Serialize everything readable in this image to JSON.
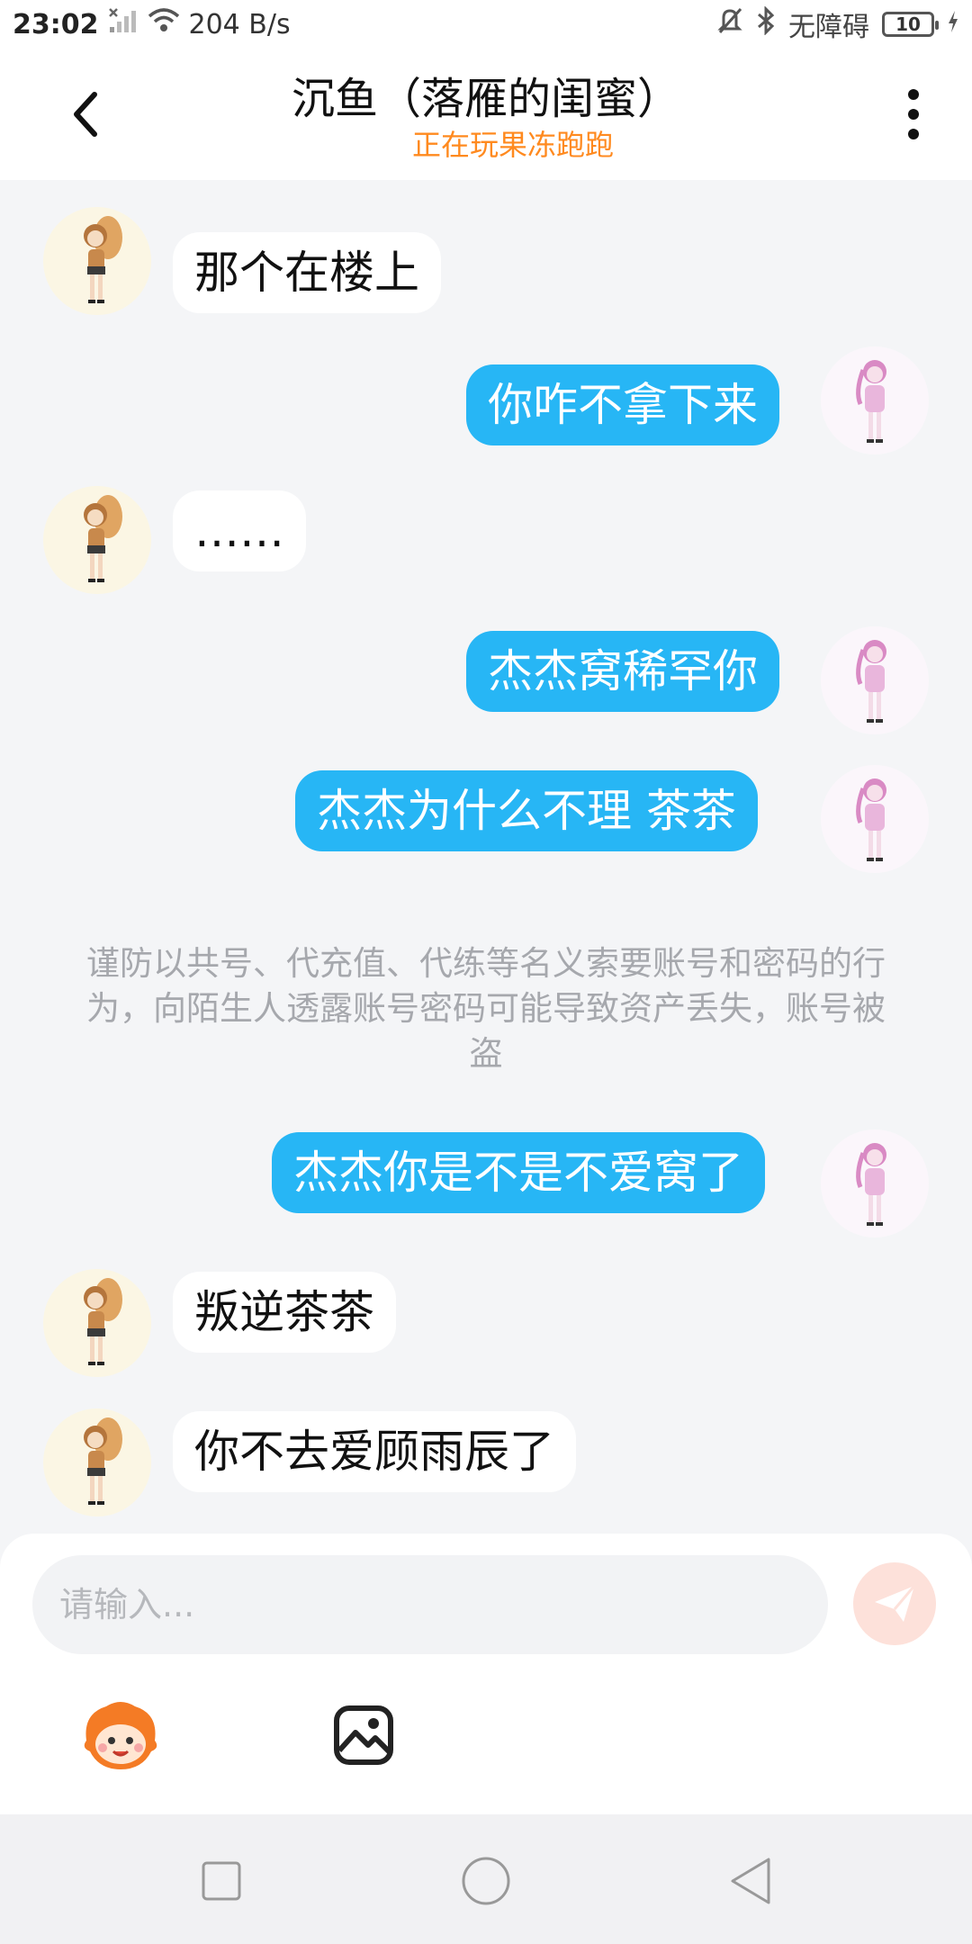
{
  "status_bar": {
    "time": "23:02",
    "net_speed": "204 B/s",
    "accessibility": "无障碍",
    "battery": "10",
    "icons": [
      "no-sim-signal-icon",
      "wifi-icon",
      "mute-icon",
      "bluetooth-icon",
      "battery-icon",
      "charging-icon"
    ]
  },
  "header": {
    "title": "沉鱼（落雁的闺蜜）",
    "subtitle": "正在玩果冻跑跑",
    "subtitle_color": "#ff8a1f",
    "back_icon": "chevron-left-icon",
    "more_icon": "more-vertical-icon"
  },
  "messages": [
    {
      "side": "in",
      "text": "那个在楼上"
    },
    {
      "side": "out",
      "text": "你咋不拿下来"
    },
    {
      "side": "in",
      "text": "……"
    },
    {
      "side": "out",
      "text": "杰杰窝稀罕你"
    },
    {
      "side": "out",
      "text": "杰杰为什么不理  茶茶"
    },
    {
      "side": "out",
      "text": "杰杰你是不是不爱窝了"
    },
    {
      "side": "in",
      "text": "叛逆茶茶"
    },
    {
      "side": "in",
      "text": "你不去爱顾雨辰了"
    }
  ],
  "security_notice": "谨防以共号、代充值、代练等名义索要账号和密码的行为，向陌生人透露账号密码可能导致资产丢失，账号被盗",
  "composer": {
    "placeholder": "请输入...",
    "send_icon": "send-icon",
    "tools": [
      "mascot-emoji-icon",
      "image-icon"
    ]
  },
  "colors": {
    "outgoing_bubble": "#27b6f5",
    "incoming_bubble": "#ffffff",
    "chat_background": "#f4f5f7",
    "send_button": "#fde1da"
  },
  "nav": [
    "recent-apps-icon",
    "home-icon",
    "back-icon"
  ]
}
